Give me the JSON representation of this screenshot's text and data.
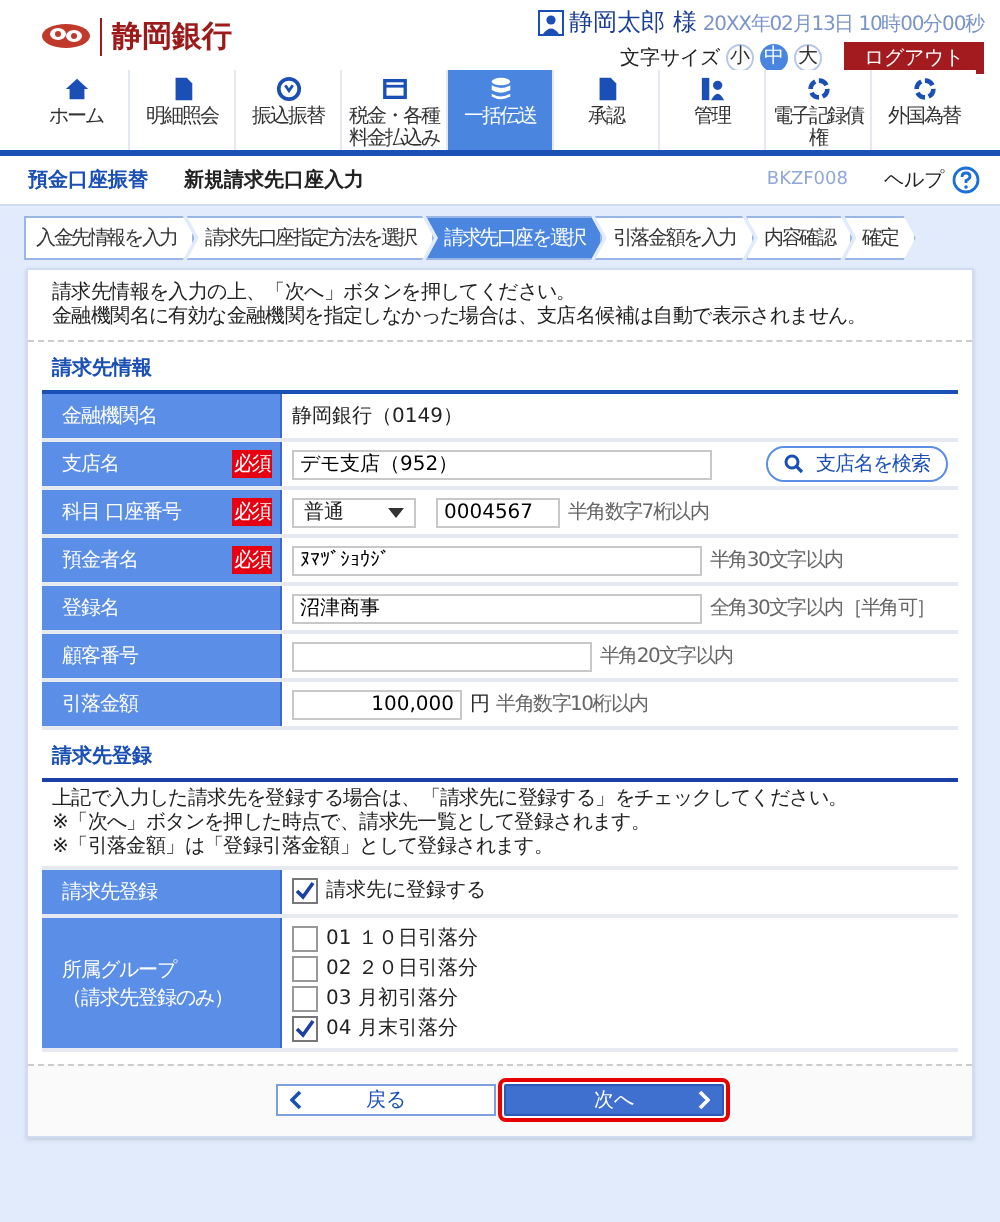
{
  "header": {
    "bank_name": "静岡銀行",
    "user_name": "静岡太郎 様",
    "datetime": "20XX年02月13日 10時00分00秒",
    "font_size_label": "文字サイズ",
    "font_sizes": [
      {
        "label": "小",
        "selected": false
      },
      {
        "label": "中",
        "selected": true
      },
      {
        "label": "大",
        "selected": false
      }
    ],
    "logout": "ログアウト"
  },
  "nav": [
    {
      "label": "ホーム",
      "selected": false
    },
    {
      "label": "明細照会",
      "selected": false
    },
    {
      "label": "振込振替",
      "selected": false
    },
    {
      "label": "税金・各種料金払込み",
      "selected": false
    },
    {
      "label": "一括伝送",
      "selected": true
    },
    {
      "label": "承認",
      "selected": false
    },
    {
      "label": "管理",
      "selected": false
    },
    {
      "label": "電子記録債権",
      "selected": false
    },
    {
      "label": "外国為替",
      "selected": false
    }
  ],
  "title_bar": {
    "category": "預金口座振替",
    "title": "新規請求先口座入力",
    "screen_id": "BKZF008",
    "help": "ヘルプ"
  },
  "steps": [
    {
      "label": "入金先情報を入力",
      "selected": false
    },
    {
      "label": "請求先口座指定方法を選択",
      "selected": false
    },
    {
      "label": "請求先口座を選択",
      "selected": true
    },
    {
      "label": "引落金額を入力",
      "selected": false
    },
    {
      "label": "内容確認",
      "selected": false
    },
    {
      "label": "確定",
      "selected": false
    }
  ],
  "instructions": [
    "請求先情報を入力の上、「次へ」ボタンを押してください。",
    "金融機関名に有効な金融機関を指定しなかった場合は、支店名候補は自動で表示されません。"
  ],
  "billing_info": {
    "heading": "請求先情報",
    "rows": [
      {
        "label": "金融機関名",
        "kind": "static",
        "value": "静岡銀行（0149）"
      },
      {
        "label": "支店名",
        "badge": "必須",
        "kind": "branch",
        "value": "デモ支店（952）",
        "button": "支店名を検索"
      },
      {
        "label": "科目 口座番号",
        "badge": "必須",
        "kind": "account",
        "select": "普通",
        "value": "0004567",
        "hint": "半角数字7桁以内"
      },
      {
        "label": "預金者名",
        "badge": "必須",
        "kind": "wide",
        "value": "ﾇﾏﾂﾞｼｮｳｼﾞ",
        "hint": "半角30文字以内"
      },
      {
        "label": "登録名",
        "kind": "wide",
        "value": "沼津商事",
        "hint": "全角30文字以内［半角可］"
      },
      {
        "label": "顧客番号",
        "kind": "short",
        "hint": "半角20文字以内"
      },
      {
        "label": "引落金額",
        "kind": "amount",
        "value": "100,000",
        "unit": "円",
        "hint": "半角数字10桁以内"
      }
    ]
  },
  "registration": {
    "heading": "請求先登録",
    "notes": [
      "上記で入力した請求先を登録する場合は、「請求先に登録する」をチェックしてください。",
      "※「次へ」ボタンを押した時点で、請求先一覧として登録されます。",
      "※「引落金額」は「登録引落金額」として登録されます。"
    ],
    "rows": [
      {
        "label": "請求先登録",
        "options": [
          {
            "label": "請求先に登録する",
            "checked": true
          }
        ]
      },
      {
        "label": "所属グループ",
        "sublabel": "（請求先登録のみ）",
        "options": [
          {
            "label": "01 １０日引落分",
            "checked": false
          },
          {
            "label": "02 ２０日引落分",
            "checked": false
          },
          {
            "label": "03 月初引落分",
            "checked": false
          },
          {
            "label": "04 月末引落分",
            "checked": true
          }
        ]
      }
    ]
  },
  "buttons": {
    "back": "戻る",
    "next": "次へ",
    "next_highlighted": true
  }
}
